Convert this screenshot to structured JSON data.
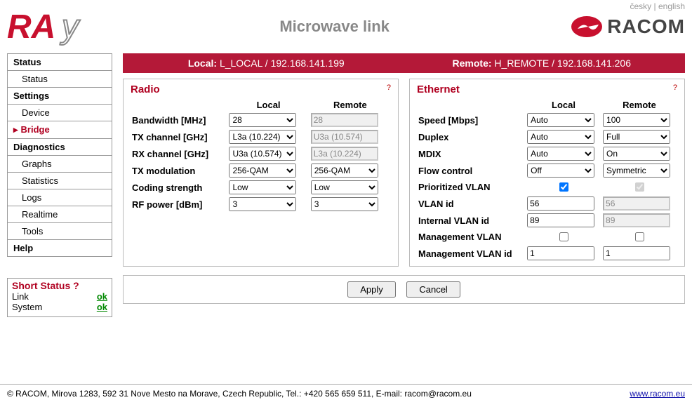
{
  "lang": {
    "cesky": "česky",
    "english": "english"
  },
  "header": {
    "title": "Microwave link",
    "brand": "RACOM",
    "logotext": "RAy"
  },
  "menu": {
    "status": "Status",
    "status_sub": "Status",
    "settings": "Settings",
    "device": "Device",
    "bridge": "Bridge",
    "diagnostics": "Diagnostics",
    "graphs": "Graphs",
    "statistics": "Statistics",
    "logs": "Logs",
    "realtime": "Realtime",
    "tools": "Tools",
    "help": "Help"
  },
  "short": {
    "title": "Short Status ?",
    "link_l": "Link",
    "link_v": "ok",
    "sys_l": "System",
    "sys_v": "ok"
  },
  "banner": {
    "local_l": "Local:",
    "local_v": "L_LOCAL / 192.168.141.199",
    "remote_l": "Remote:",
    "remote_v": "H_REMOTE / 192.168.141.206"
  },
  "cols": {
    "local": "Local",
    "remote": "Remote"
  },
  "radio": {
    "title": "Radio",
    "bw_l": "Bandwidth [MHz]",
    "bw_local": "28",
    "bw_remote": "28",
    "txch_l": "TX channel [GHz]",
    "txch_local": "L3a (10.224)",
    "txch_remote": "U3a (10.574)",
    "rxch_l": "RX channel [GHz]",
    "rxch_local": "U3a (10.574)",
    "rxch_remote": "L3a (10.224)",
    "mod_l": "TX modulation",
    "mod_local": "256-QAM",
    "mod_remote": "256-QAM",
    "cod_l": "Coding strength",
    "cod_local": "Low",
    "cod_remote": "Low",
    "rfp_l": "RF power [dBm]",
    "rfp_local": "3",
    "rfp_remote": "3"
  },
  "eth": {
    "title": "Ethernet",
    "spd_l": "Speed [Mbps]",
    "spd_local": "Auto",
    "spd_remote": "100",
    "dup_l": "Duplex",
    "dup_local": "Auto",
    "dup_remote": "Full",
    "mdix_l": "MDIX",
    "mdix_local": "Auto",
    "mdix_remote": "On",
    "flow_l": "Flow control",
    "flow_local": "Off",
    "flow_remote": "Symmetric",
    "pvlan_l": "Prioritized VLAN",
    "vlanid_l": "VLAN id",
    "vlanid_local": "56",
    "vlanid_remote": "56",
    "ivlan_l": "Internal VLAN id",
    "ivlan_local": "89",
    "ivlan_remote": "89",
    "mvlan_l": "Management VLAN",
    "mvlanid_l": "Management VLAN id",
    "mvlanid_local": "1",
    "mvlanid_remote": "1"
  },
  "btns": {
    "apply": "Apply",
    "cancel": "Cancel"
  },
  "footer": {
    "copy": "© RACOM, Mirova 1283, 592 31 Nove Mesto na Morave, Czech Republic, Tel.: +420 565 659 511, E-mail: racom@racom.eu",
    "url": "www.racom.eu"
  }
}
